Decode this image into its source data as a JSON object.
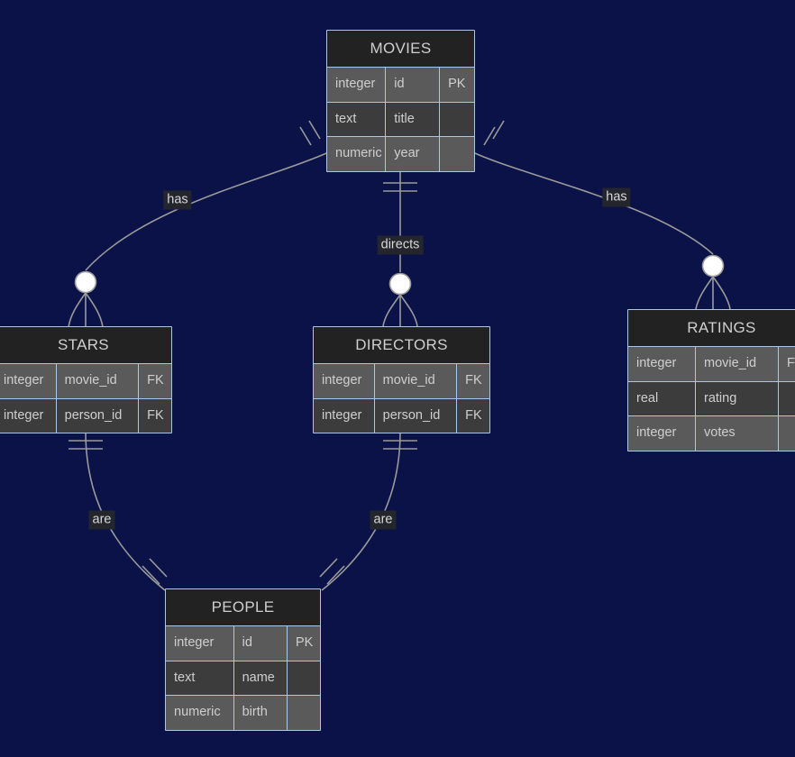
{
  "diagram": {
    "kind": "entity-relationship-diagram",
    "background_color": "#0a1248",
    "entity_border_color": "#a9c8e8",
    "entity_header_color": "#222222",
    "line_color": "#9a9a9a",
    "marker_fill_color": "#ffffff",
    "entities": [
      {
        "id": "movies",
        "name": "MOVIES",
        "attributes": [
          {
            "type": "integer",
            "name": "id",
            "key": "PK"
          },
          {
            "type": "text",
            "name": "title",
            "key": ""
          },
          {
            "type": "numeric",
            "name": "year",
            "key": ""
          }
        ]
      },
      {
        "id": "stars",
        "name": "STARS",
        "attributes": [
          {
            "type": "integer",
            "name": "movie_id",
            "key": "FK"
          },
          {
            "type": "integer",
            "name": "person_id",
            "key": "FK"
          }
        ]
      },
      {
        "id": "directors",
        "name": "DIRECTORS",
        "attributes": [
          {
            "type": "integer",
            "name": "movie_id",
            "key": "FK"
          },
          {
            "type": "integer",
            "name": "person_id",
            "key": "FK"
          }
        ]
      },
      {
        "id": "ratings",
        "name": "RATINGS",
        "attributes": [
          {
            "type": "integer",
            "name": "movie_id",
            "key": "FK"
          },
          {
            "type": "real",
            "name": "rating",
            "key": ""
          },
          {
            "type": "integer",
            "name": "votes",
            "key": ""
          }
        ]
      },
      {
        "id": "people",
        "name": "PEOPLE",
        "attributes": [
          {
            "type": "integer",
            "name": "id",
            "key": "PK"
          },
          {
            "type": "text",
            "name": "name",
            "key": ""
          },
          {
            "type": "numeric",
            "name": "birth",
            "key": ""
          }
        ]
      }
    ],
    "relationships": [
      {
        "id": "movies-stars",
        "from": "MOVIES",
        "to": "STARS",
        "label": "has"
      },
      {
        "id": "movies-directors",
        "from": "MOVIES",
        "to": "DIRECTORS",
        "label": "directs"
      },
      {
        "id": "movies-ratings",
        "from": "MOVIES",
        "to": "RATINGS",
        "label": "has"
      },
      {
        "id": "stars-people",
        "from": "STARS",
        "to": "PEOPLE",
        "label": "are"
      },
      {
        "id": "directors-people",
        "from": "DIRECTORS",
        "to": "PEOPLE",
        "label": "are"
      }
    ]
  }
}
